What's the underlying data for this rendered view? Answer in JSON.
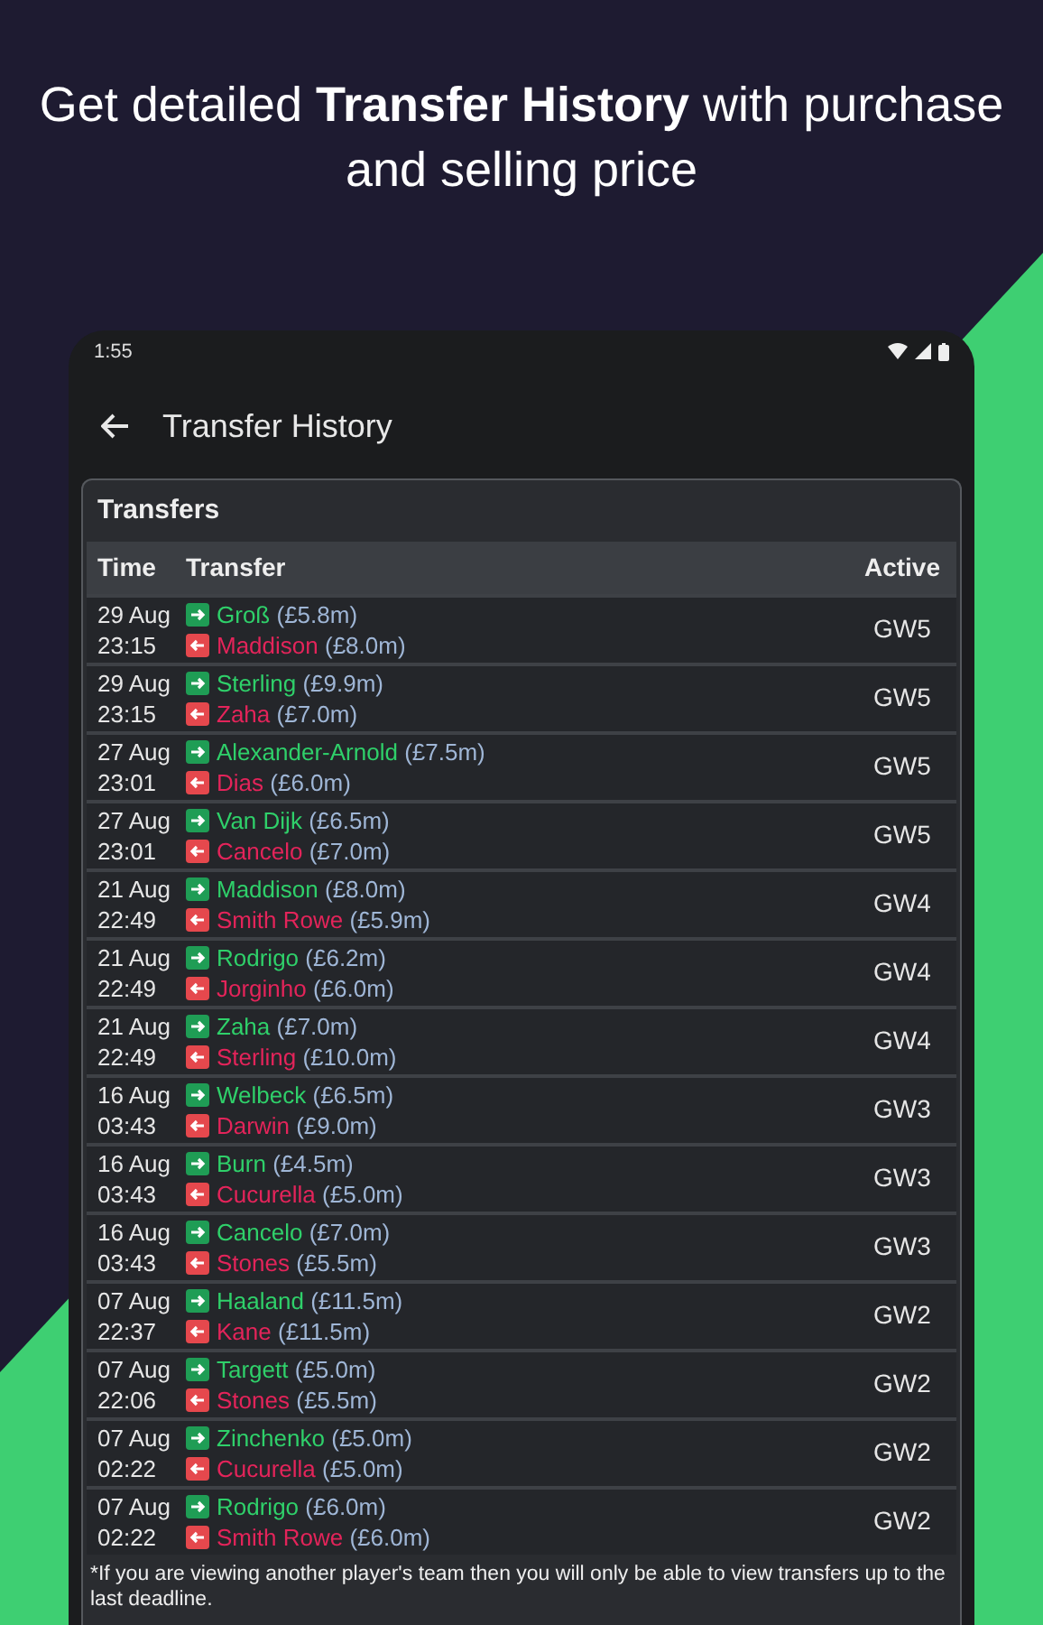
{
  "headline": "Get detailed **Transfer History** with purchase and selling price",
  "status_bar": {
    "time": "1:55"
  },
  "app_bar": {
    "title": "Transfer History"
  },
  "card": {
    "title": "Transfers",
    "columns": [
      "Time",
      "Transfer",
      "Active"
    ],
    "rows": [
      {
        "date": "29 Aug",
        "time": "23:15",
        "in": {
          "name": "Groß",
          "price": "(£5.8m)"
        },
        "out": {
          "name": "Maddison",
          "price": "(£8.0m)"
        },
        "gameweek": "GW5"
      },
      {
        "date": "29 Aug",
        "time": "23:15",
        "in": {
          "name": "Sterling",
          "price": "(£9.9m)"
        },
        "out": {
          "name": "Zaha",
          "price": "(£7.0m)"
        },
        "gameweek": "GW5"
      },
      {
        "date": "27 Aug",
        "time": "23:01",
        "in": {
          "name": "Alexander-Arnold",
          "price": "(£7.5m)"
        },
        "out": {
          "name": "Dias",
          "price": "(£6.0m)"
        },
        "gameweek": "GW5"
      },
      {
        "date": "27 Aug",
        "time": "23:01",
        "in": {
          "name": "Van Dijk",
          "price": "(£6.5m)"
        },
        "out": {
          "name": "Cancelo",
          "price": "(£7.0m)"
        },
        "gameweek": "GW5"
      },
      {
        "date": "21 Aug",
        "time": "22:49",
        "in": {
          "name": "Maddison",
          "price": "(£8.0m)"
        },
        "out": {
          "name": "Smith Rowe",
          "price": "(£5.9m)"
        },
        "gameweek": "GW4"
      },
      {
        "date": "21 Aug",
        "time": "22:49",
        "in": {
          "name": "Rodrigo",
          "price": "(£6.2m)"
        },
        "out": {
          "name": "Jorginho",
          "price": "(£6.0m)"
        },
        "gameweek": "GW4"
      },
      {
        "date": "21 Aug",
        "time": "22:49",
        "in": {
          "name": "Zaha",
          "price": "(£7.0m)"
        },
        "out": {
          "name": "Sterling",
          "price": "(£10.0m)"
        },
        "gameweek": "GW4"
      },
      {
        "date": "16 Aug",
        "time": "03:43",
        "in": {
          "name": "Welbeck",
          "price": "(£6.5m)"
        },
        "out": {
          "name": "Darwin",
          "price": "(£9.0m)"
        },
        "gameweek": "GW3"
      },
      {
        "date": "16 Aug",
        "time": "03:43",
        "in": {
          "name": "Burn",
          "price": "(£4.5m)"
        },
        "out": {
          "name": "Cucurella",
          "price": "(£5.0m)"
        },
        "gameweek": "GW3"
      },
      {
        "date": "16 Aug",
        "time": "03:43",
        "in": {
          "name": "Cancelo",
          "price": "(£7.0m)"
        },
        "out": {
          "name": "Stones",
          "price": "(£5.5m)"
        },
        "gameweek": "GW3"
      },
      {
        "date": "07 Aug",
        "time": "22:37",
        "in": {
          "name": "Haaland",
          "price": "(£11.5m)"
        },
        "out": {
          "name": "Kane",
          "price": "(£11.5m)"
        },
        "gameweek": "GW2"
      },
      {
        "date": "07 Aug",
        "time": "22:06",
        "in": {
          "name": "Targett",
          "price": "(£5.0m)"
        },
        "out": {
          "name": "Stones",
          "price": "(£5.5m)"
        },
        "gameweek": "GW2"
      },
      {
        "date": "07 Aug",
        "time": "02:22",
        "in": {
          "name": "Zinchenko",
          "price": "(£5.0m)"
        },
        "out": {
          "name": "Cucurella",
          "price": "(£5.0m)"
        },
        "gameweek": "GW2"
      },
      {
        "date": "07 Aug",
        "time": "02:22",
        "in": {
          "name": "Rodrigo",
          "price": "(£6.0m)"
        },
        "out": {
          "name": "Smith Rowe",
          "price": "(£6.0m)"
        },
        "gameweek": "GW2"
      }
    ],
    "footnote": "*If you are viewing another player's team then you will only be able to view transfers up to the last deadline."
  }
}
